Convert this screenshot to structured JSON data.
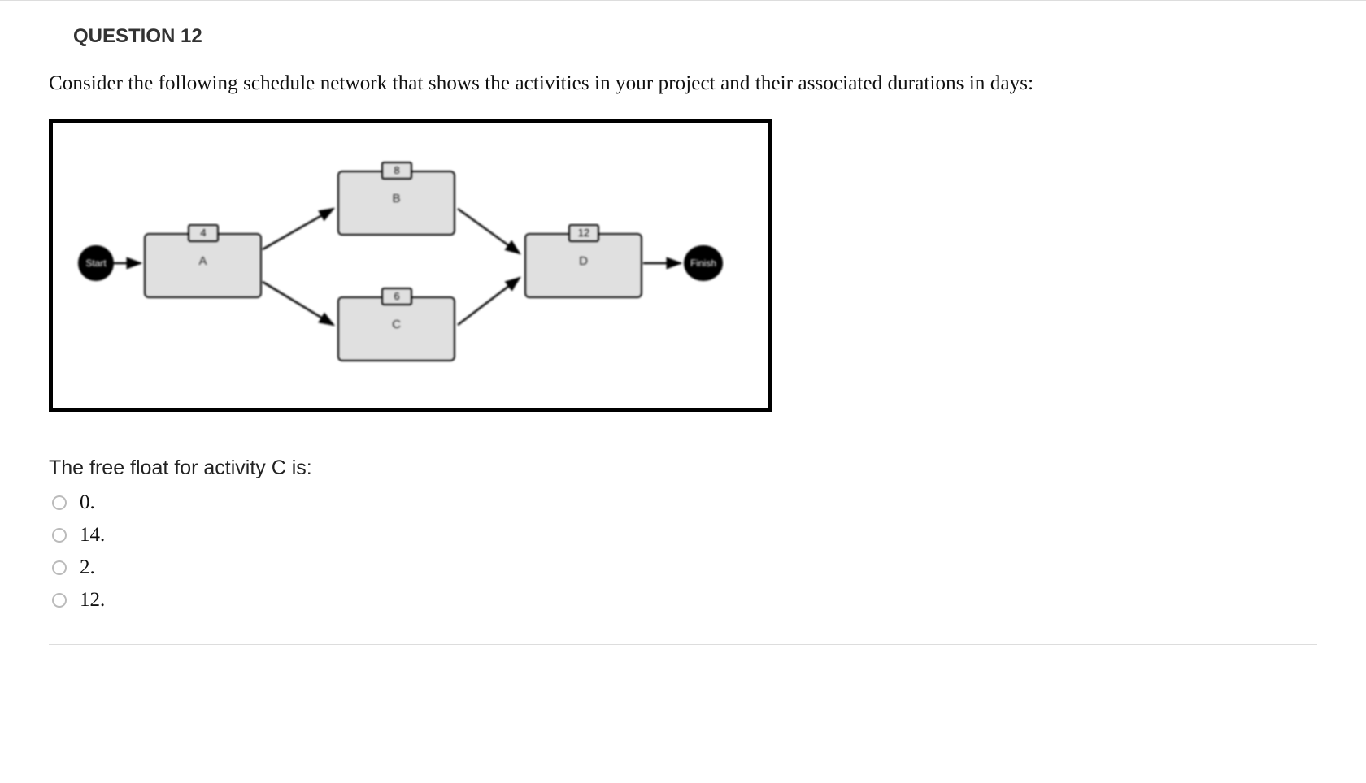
{
  "question": {
    "header": "QUESTION 12",
    "prompt": "Consider the following schedule network that shows the activities in your project and their associated durations in days:",
    "sub_prompt": "The free float for activity C is:"
  },
  "diagram": {
    "start_label": "Start",
    "finish_label": "Finish",
    "nodes": {
      "A": {
        "label": "A",
        "duration": "4"
      },
      "B": {
        "label": "B",
        "duration": "8"
      },
      "C": {
        "label": "C",
        "duration": "6"
      },
      "D": {
        "label": "D",
        "duration": "12"
      }
    }
  },
  "options": [
    {
      "text": "0."
    },
    {
      "text": "14."
    },
    {
      "text": "2."
    },
    {
      "text": "12."
    }
  ]
}
